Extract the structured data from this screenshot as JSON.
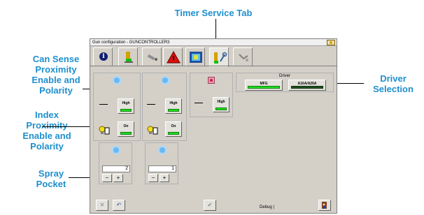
{
  "window": {
    "title": "Gun configuration - GUNCONTROLLER3"
  },
  "callouts": {
    "timer_service_tab": "Timer Service Tab",
    "can_sense": "Can Sense Proximity Enable and Polarity",
    "index_proximity": "Index Proximity Enable and Polarity",
    "spray_pocket": "Spray Pocket",
    "driver_selection": "Driver Selection"
  },
  "tabs": [
    {
      "icon": "info-icon"
    },
    {
      "icon": "gun-green-icon"
    },
    {
      "icon": "nozzle-icon"
    },
    {
      "icon": "warning-triangle-icon"
    },
    {
      "icon": "diagnostics-icon"
    },
    {
      "icon": "timer-service-icon",
      "active": true
    },
    {
      "icon": "spray-gun-icon"
    }
  ],
  "can_sense": [
    {
      "polarity_label": "High"
    },
    {
      "polarity_label": "High"
    }
  ],
  "index_prox": [
    {
      "enable_label": "On"
    },
    {
      "enable_label": "On"
    }
  ],
  "third_panel": {
    "polarity_label": "High"
  },
  "driver": {
    "title": "Driver",
    "options": [
      {
        "label": "MFG",
        "state_color": "#20e020"
      },
      {
        "label": "A16A/A26A",
        "state_color": "#205020"
      }
    ]
  },
  "spray_pockets": [
    {
      "value": "2",
      "minus": "−",
      "plus": "+"
    },
    {
      "value": "1",
      "minus": "−",
      "plus": "+"
    }
  ],
  "footer": {
    "cancel": "✕",
    "undo": "↶",
    "ok": "✔",
    "debug_label": "Debug |"
  }
}
